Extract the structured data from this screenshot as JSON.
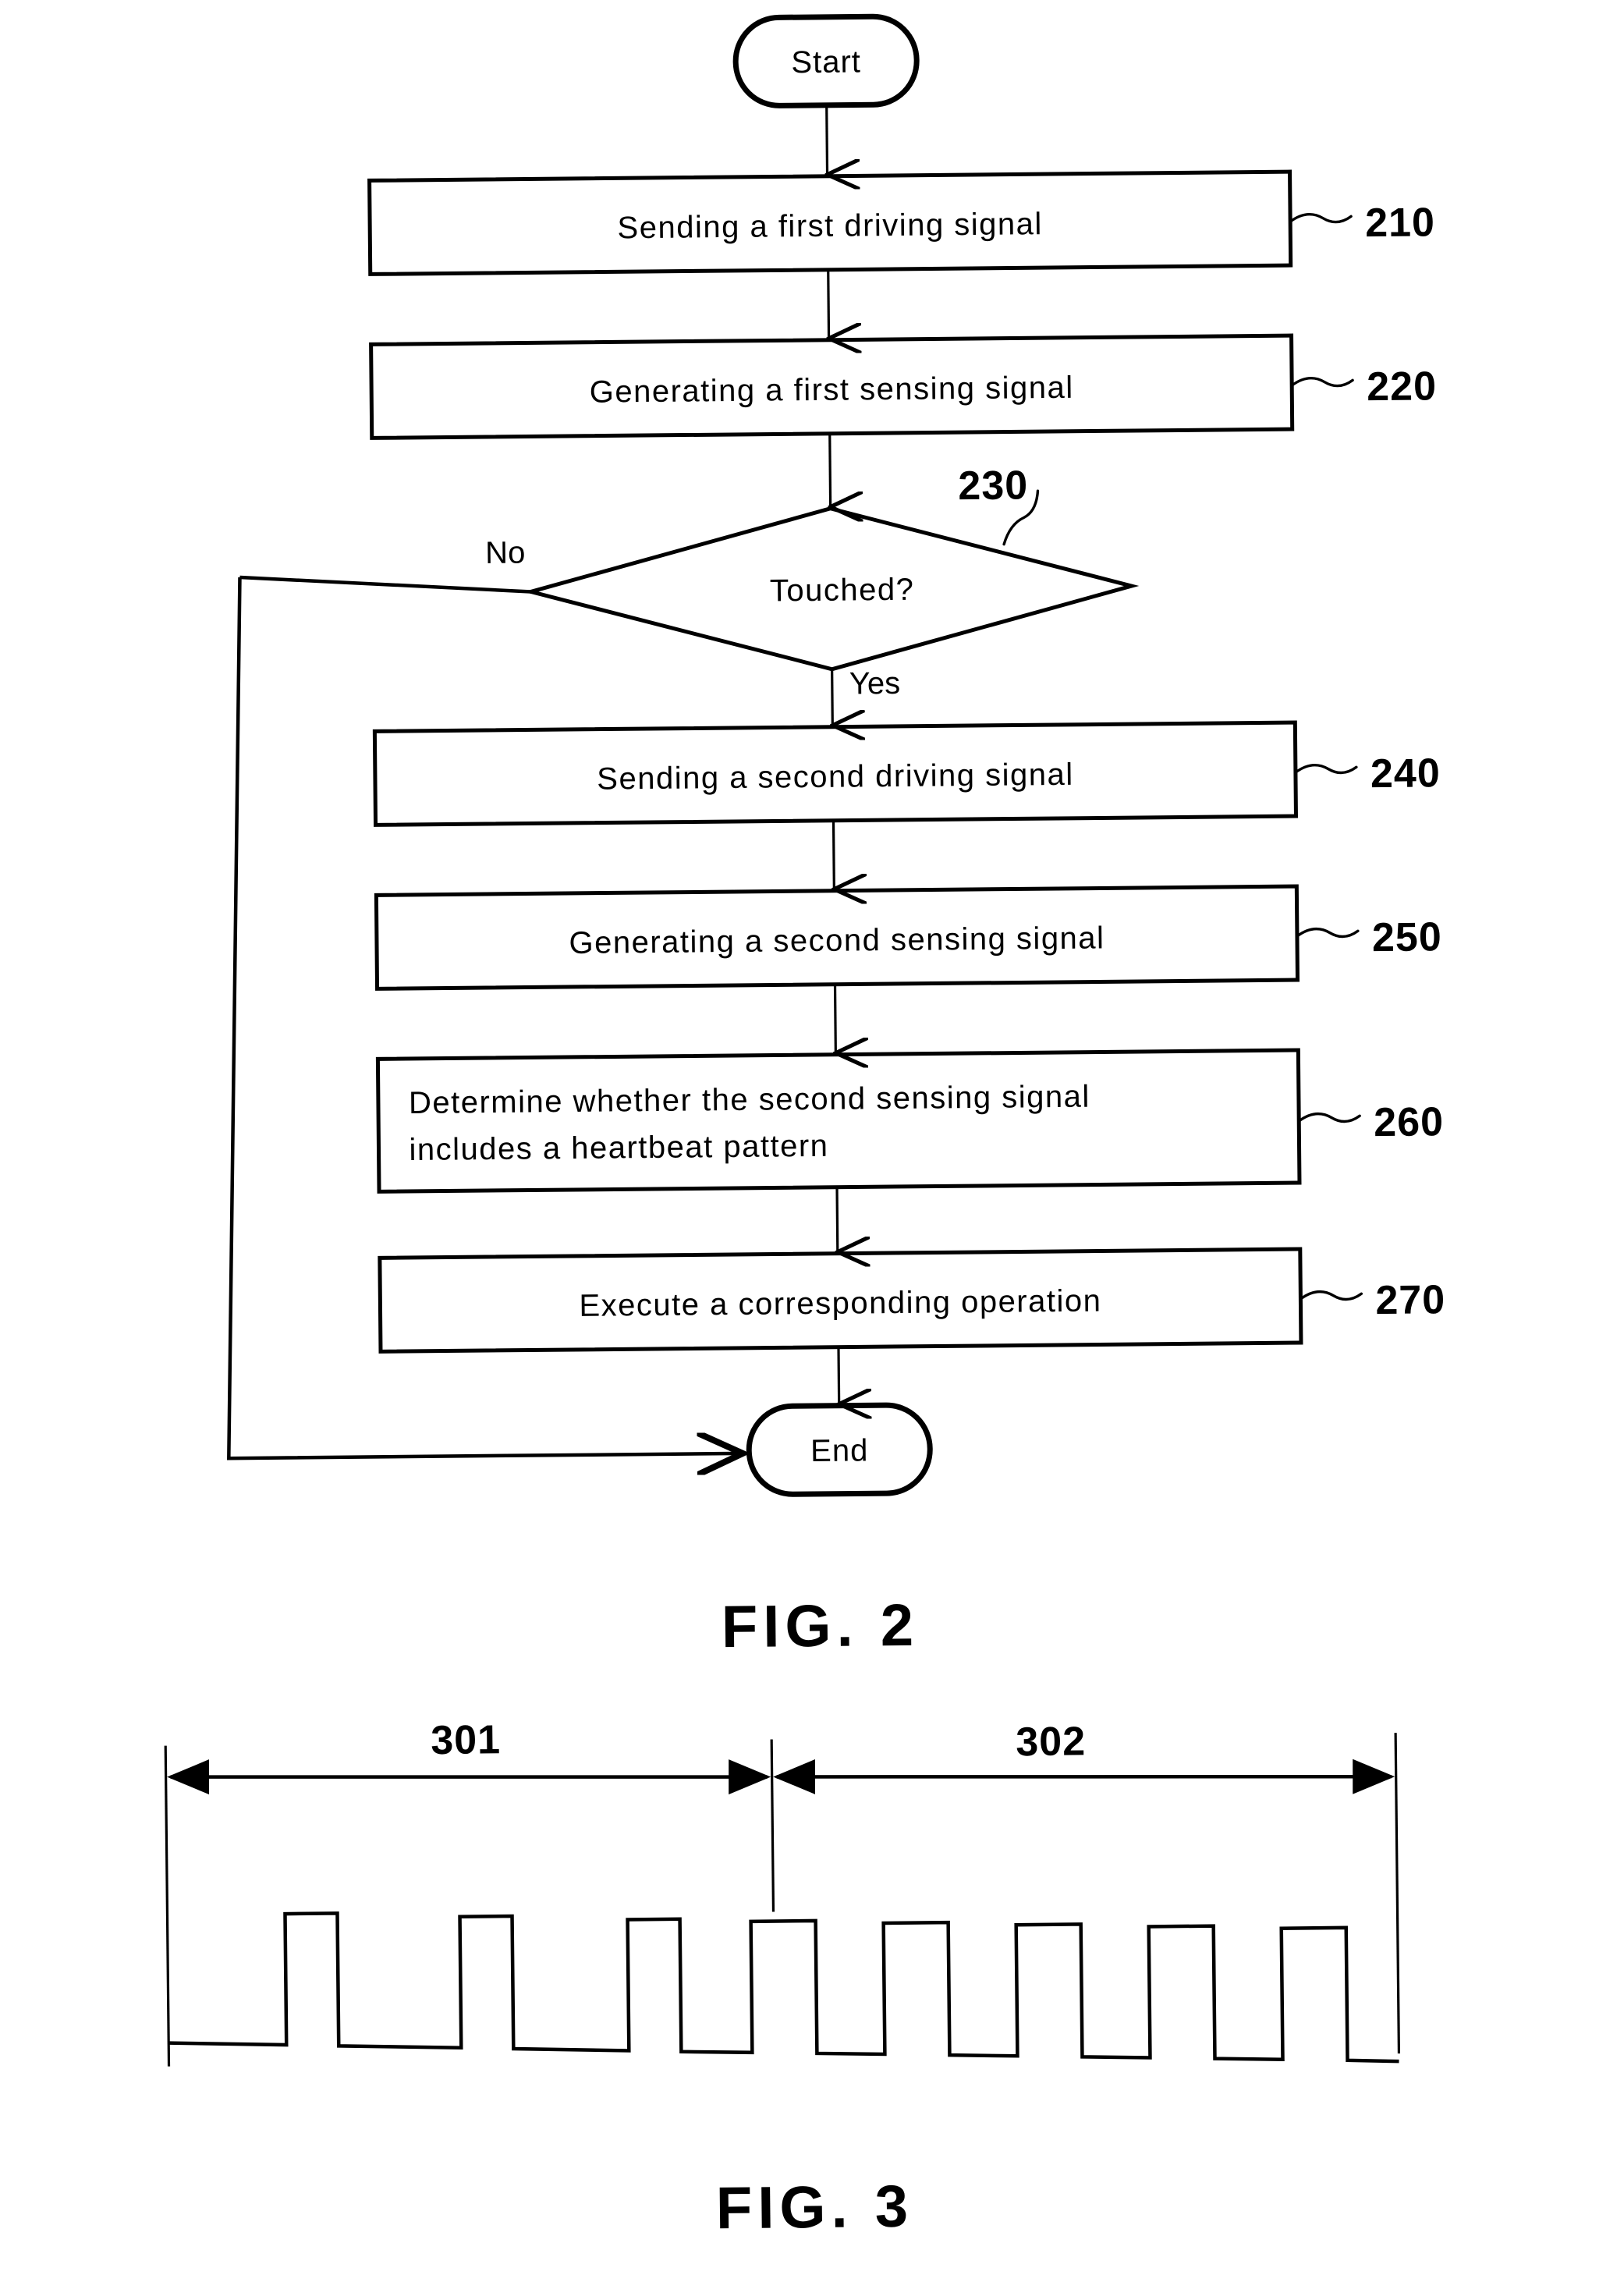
{
  "document": {
    "type": "patent-figure-sheet",
    "figures": [
      "FIG. 2",
      "FIG. 3"
    ]
  },
  "figure2": {
    "caption": "FIG. 2",
    "start_node": {
      "label": "Start",
      "shape": "stadium"
    },
    "end_node": {
      "label": "End",
      "shape": "stadium"
    },
    "steps": [
      {
        "ref": "210",
        "label": "Sending a first driving signal",
        "align": "center"
      },
      {
        "ref": "220",
        "label": "Generating a first sensing signal",
        "align": "center"
      },
      {
        "ref": "240",
        "label": "Sending a second driving signal",
        "align": "center"
      },
      {
        "ref": "250",
        "label": "Generating a second sensing signal",
        "align": "center"
      },
      {
        "ref": "260",
        "label_line1": "Determine whether the second sensing signal",
        "label_line2": "includes a heartbeat pattern",
        "align": "left"
      },
      {
        "ref": "270",
        "label": "Execute a corresponding operation",
        "align": "center"
      }
    ],
    "decision": {
      "ref": "230",
      "label": "Touched?",
      "yes_label": "Yes",
      "no_label": "No",
      "shape": "diamond"
    }
  },
  "figure3": {
    "caption": "FIG. 3",
    "segments": [
      {
        "ref": "301",
        "name": "first-driving-signal-period"
      },
      {
        "ref": "302",
        "name": "second-driving-signal-period"
      }
    ],
    "chart_data": {
      "type": "line",
      "title": "FIG. 3",
      "xlabel": "",
      "ylabel": "",
      "description": "Digital pulse train waveform split into two labelled periods: 301 (low frequency, narrow widely spaced pulses) and 302 (higher frequency, wider closely spaced pulses).",
      "levels": {
        "low": 0,
        "high": 1
      },
      "ylim": [
        0,
        1
      ],
      "xlim": [
        0,
        100
      ],
      "grid": false,
      "legend": "none",
      "segment_boundary_x": 49,
      "pulses": [
        {
          "segment": "301",
          "rise_x": 9.0,
          "fall_x": 12.6,
          "level": 1
        },
        {
          "segment": "301",
          "rise_x": 22.0,
          "fall_x": 25.6,
          "level": 1
        },
        {
          "segment": "301",
          "rise_x": 35.3,
          "fall_x": 38.9,
          "level": 1
        },
        {
          "segment": "302",
          "rise_x": 48.0,
          "fall_x": 52.5,
          "level": 1
        },
        {
          "segment": "302",
          "rise_x": 57.4,
          "fall_x": 62.0,
          "level": 1
        },
        {
          "segment": "302",
          "rise_x": 66.9,
          "fall_x": 71.4,
          "level": 1
        },
        {
          "segment": "302",
          "rise_x": 76.3,
          "fall_x": 80.8,
          "level": 1
        },
        {
          "segment": "302",
          "rise_x": 85.7,
          "fall_x": 90.3,
          "level": 1
        }
      ],
      "pulse_counts": {
        "301": 3,
        "302": 5
      },
      "annotations": [
        {
          "text": "301",
          "type": "dimension-span",
          "from_x": 0,
          "to_x": 49
        },
        {
          "text": "302",
          "type": "dimension-span",
          "from_x": 49,
          "to_x": 100
        }
      ]
    }
  }
}
